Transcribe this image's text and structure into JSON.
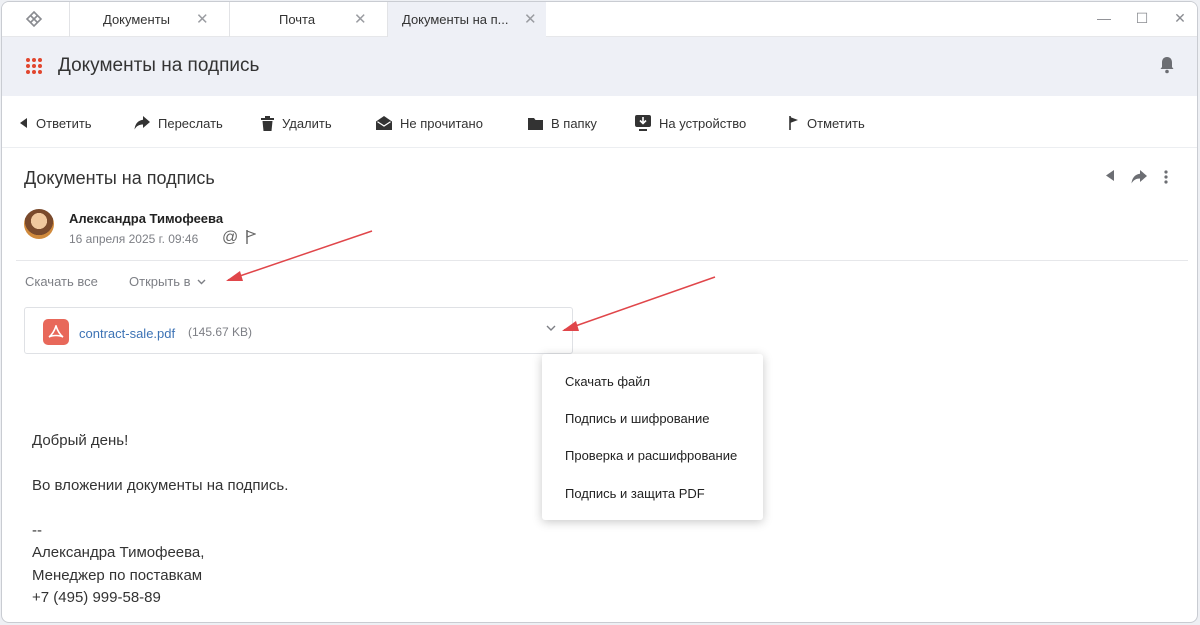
{
  "tabs": [
    {
      "label": "Документы",
      "active": false
    },
    {
      "label": "Почта",
      "active": false
    },
    {
      "label": "Документы на п...",
      "active": true
    }
  ],
  "header": {
    "title": "Документы на подпись"
  },
  "toolbar": {
    "reply": "Ответить",
    "forward": "Переслать",
    "delete": "Удалить",
    "unread": "Не прочитано",
    "to_folder": "В папку",
    "to_device": "На устройство",
    "mark": "Отметить"
  },
  "message": {
    "subject": "Документы на подпись",
    "sender": "Александра Тимофеева",
    "date": "16 апреля 2025 г. 09:46"
  },
  "attachments": {
    "download_all": "Скачать все",
    "open_in": "Открыть в",
    "file_name": "contract-sale.pdf",
    "file_size": "(145.67 KB)"
  },
  "dropdown": [
    "Скачать файл",
    "Подпись и шифрование",
    "Проверка и расшифрование",
    "Подпись и защита PDF"
  ],
  "body": {
    "greeting": "Добрый день!",
    "text": "Во вложении документы на подпись.",
    "sig_sep": "--",
    "sig_name": "Александра Тимофеева,",
    "sig_role": "Менеджер по поставкам",
    "sig_phone": "+7 (495) 999-58-89"
  },
  "colors": {
    "accent": "#e2462e",
    "link": "#3d73b5",
    "pdf": "#e8685a",
    "annotation_arrow": "#e0464a"
  }
}
